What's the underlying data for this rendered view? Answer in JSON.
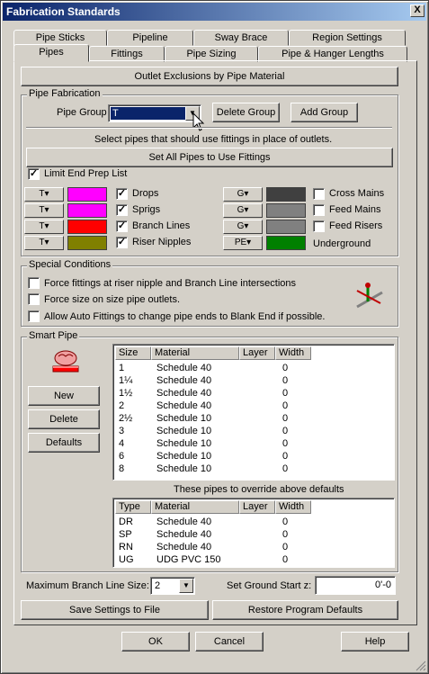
{
  "window": {
    "title": "Fabrication Standards",
    "close": "X"
  },
  "tabs_top": [
    "Pipe Sticks",
    "Pipeline",
    "Sway Brace",
    "Region Settings"
  ],
  "tabs_bottom": [
    "Pipes",
    "Fittings",
    "Pipe Sizing",
    "Pipe & Hanger Lengths"
  ],
  "outlet_button": "Outlet Exclusions by Pipe Material",
  "fab": {
    "label": "Pipe Fabrication",
    "group_label": "Pipe Group",
    "group_value": "T",
    "delete_group": "Delete Group",
    "add_group": "Add Group",
    "select_text": "Select pipes that should use fittings in place of outlets.",
    "set_all": "Set All Pipes to Use Fittings",
    "limit_label": "Limit End Prep List",
    "limit_checked": "✓",
    "left_items": [
      {
        "drop": "T",
        "color": "#ff00ff",
        "check": "✓",
        "label": "Drops"
      },
      {
        "drop": "T",
        "color": "#ff00ff",
        "check": "✓",
        "label": "Sprigs"
      },
      {
        "drop": "T",
        "color": "#ff0000",
        "check": "✓",
        "label": "Branch Lines"
      },
      {
        "drop": "T",
        "color": "#808000",
        "check": "✓",
        "label": "Riser Nipples"
      }
    ],
    "right_items": [
      {
        "drop": "G",
        "color": "#404040",
        "check": "",
        "label": "Cross Mains"
      },
      {
        "drop": "G",
        "color": "#808080",
        "check": "",
        "label": "Feed Mains"
      },
      {
        "drop": "G",
        "color": "#808080",
        "check": "",
        "label": "Feed Risers"
      },
      {
        "drop": "PE",
        "color": "#008000",
        "check": null,
        "label": "Underground"
      }
    ]
  },
  "special": {
    "label": "Special Conditions",
    "items": [
      "Force fittings at riser nipple and Branch Line intersections",
      "Force size on size pipe outlets.",
      "Allow Auto Fittings to change pipe ends to Blank End if possible."
    ]
  },
  "smart": {
    "label": "Smart Pipe",
    "new": "New",
    "delete": "Delete",
    "defaults": "Defaults",
    "headers": [
      "Size",
      "Material",
      "Layer",
      "Width"
    ],
    "rows": [
      [
        "1",
        "Schedule 40",
        "",
        "0"
      ],
      [
        "1¼",
        "Schedule 40",
        "",
        "0"
      ],
      [
        "1½",
        "Schedule 40",
        "",
        "0"
      ],
      [
        "2",
        "Schedule 40",
        "",
        "0"
      ],
      [
        "2½",
        "Schedule 10",
        "",
        "0"
      ],
      [
        "3",
        "Schedule 10",
        "",
        "0"
      ],
      [
        "4",
        "Schedule 10",
        "",
        "0"
      ],
      [
        "6",
        "Schedule 10",
        "",
        "0"
      ],
      [
        "8",
        "Schedule 10",
        "",
        "0"
      ]
    ],
    "override_text": "These pipes to override above defaults",
    "headers2": [
      "Type",
      "Material",
      "Layer",
      "Width"
    ],
    "rows2": [
      [
        "DR",
        "Schedule 40",
        "",
        "0"
      ],
      [
        "SP",
        "Schedule 40",
        "",
        "0"
      ],
      [
        "RN",
        "Schedule 40",
        "",
        "0"
      ],
      [
        "UG",
        "UDG PVC 150",
        "",
        "0"
      ]
    ]
  },
  "bottom": {
    "max_branch_label": "Maximum Branch Line Size:",
    "max_branch_value": "2",
    "ground_label": "Set Ground Start z:",
    "ground_value": "0'-0",
    "save": "Save Settings to File",
    "restore": "Restore Program Defaults",
    "ok": "OK",
    "cancel": "Cancel",
    "help": "Help"
  }
}
